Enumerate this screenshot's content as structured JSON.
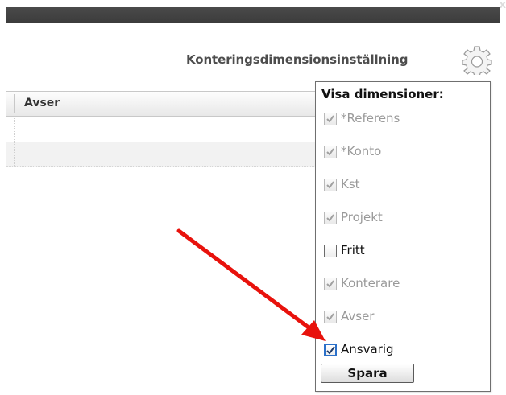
{
  "window": {
    "close_label": "x"
  },
  "header": {
    "title": "Konteringsdimensionsinställning",
    "settings_icon": "gear-icon"
  },
  "table": {
    "columns": [
      "Avser"
    ]
  },
  "popup": {
    "title": "Visa dimensioner:",
    "options": [
      {
        "label": "*Referens",
        "checked": true,
        "enabled": false
      },
      {
        "label": "*Konto",
        "checked": true,
        "enabled": false
      },
      {
        "label": "Kst",
        "checked": true,
        "enabled": false
      },
      {
        "label": "Projekt",
        "checked": true,
        "enabled": false
      },
      {
        "label": "Fritt",
        "checked": false,
        "enabled": true
      },
      {
        "label": "Konterare",
        "checked": true,
        "enabled": false
      },
      {
        "label": "Avser",
        "checked": true,
        "enabled": false
      },
      {
        "label": "Ansvarig",
        "checked": true,
        "enabled": true
      }
    ],
    "save_label": "Spara"
  },
  "annotation": {
    "arrow_color": "#e8120c"
  }
}
